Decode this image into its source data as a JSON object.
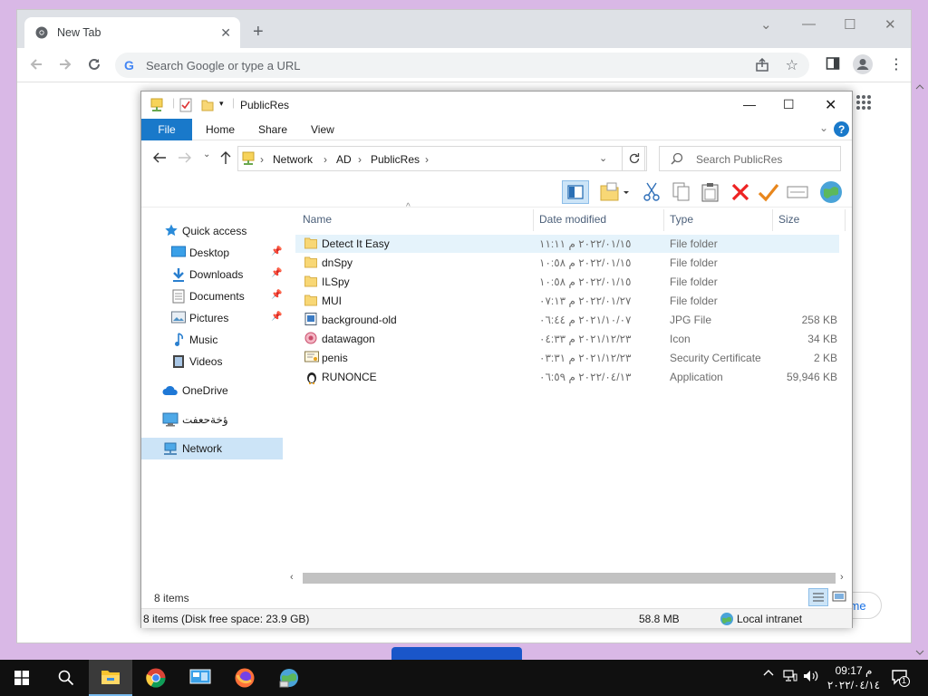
{
  "browser": {
    "tab_title": "New Tab",
    "omnibox_placeholder": "Search Google or type a URL",
    "bottom_pill_text": "rome"
  },
  "explorer": {
    "title": "PublicRes",
    "ribbon_tabs": [
      "File",
      "Home",
      "Share",
      "View"
    ],
    "breadcrumb": [
      "Network",
      "AD",
      "PublicRes"
    ],
    "search_placeholder": "Search PublicRes",
    "nav": [
      {
        "label": "Quick access",
        "icon": "star-icon"
      },
      {
        "label": "Desktop",
        "icon": "desktop-icon",
        "pinned": true
      },
      {
        "label": "Downloads",
        "icon": "download-icon",
        "pinned": true
      },
      {
        "label": "Documents",
        "icon": "documents-icon",
        "pinned": true
      },
      {
        "label": "Pictures",
        "icon": "pictures-icon",
        "pinned": true
      },
      {
        "label": "Music",
        "icon": "music-icon"
      },
      {
        "label": "Videos",
        "icon": "videos-icon"
      },
      {
        "label": "OneDrive",
        "icon": "cloud-icon"
      },
      {
        "label": "ؤخةحعفت",
        "icon": "computer-icon"
      },
      {
        "label": "Network",
        "icon": "network-icon",
        "selected": true
      }
    ],
    "columns": [
      "Name",
      "Date modified",
      "Type",
      "Size"
    ],
    "files": [
      {
        "name": "Detect It Easy",
        "date": "٢٠٢٢/٠١/١٥ م ١١:١١",
        "type": "File folder",
        "size": "",
        "icon": "folder-icon"
      },
      {
        "name": "dnSpy",
        "date": "٢٠٢٢/٠١/١٥ م ١٠:٥٨",
        "type": "File folder",
        "size": "",
        "icon": "folder-icon"
      },
      {
        "name": "ILSpy",
        "date": "٢٠٢٢/٠١/١٥ م ١٠:٥٨",
        "type": "File folder",
        "size": "",
        "icon": "folder-icon"
      },
      {
        "name": "MUI",
        "date": "٢٠٢٢/٠١/٢٧ م ٠٧:١٣",
        "type": "File folder",
        "size": "",
        "icon": "folder-icon"
      },
      {
        "name": "background-old",
        "date": "٢٠٢١/١٠/٠٧ م ٠٦:٤٤",
        "type": "JPG File",
        "size": "258 KB",
        "icon": "image-file-icon"
      },
      {
        "name": "datawagon",
        "date": "٢٠٢١/١٢/٢٣ م ٠٤:٣٣",
        "type": "Icon",
        "size": "34 KB",
        "icon": "icon-file-icon"
      },
      {
        "name": "penis",
        "date": "٢٠٢١/١٢/٢٣ م ٠٣:٣١",
        "type": "Security Certificate",
        "size": "2 KB",
        "icon": "certificate-icon"
      },
      {
        "name": "RUNONCE",
        "date": "٢٠٢٢/٠٤/١٣ م ٠٦:٥٩",
        "type": "Application",
        "size": "59,946 KB",
        "icon": "application-icon"
      }
    ],
    "status_count": "8 items",
    "status_bar": {
      "summary": "8 items (Disk free space: 23.9 GB)",
      "size": "58.8 MB",
      "zone": "Local intranet"
    }
  },
  "taskbar": {
    "clock_time": "09:17 م",
    "clock_date": "٢٠٢٢/٠٤/١٤",
    "notification_count": "1"
  },
  "colors": {
    "file_tab": "#1979ca",
    "selected_nav": "#cce4f7",
    "hover_row": "#e5f3fb",
    "desktop_bg": "#d9b8e6"
  }
}
